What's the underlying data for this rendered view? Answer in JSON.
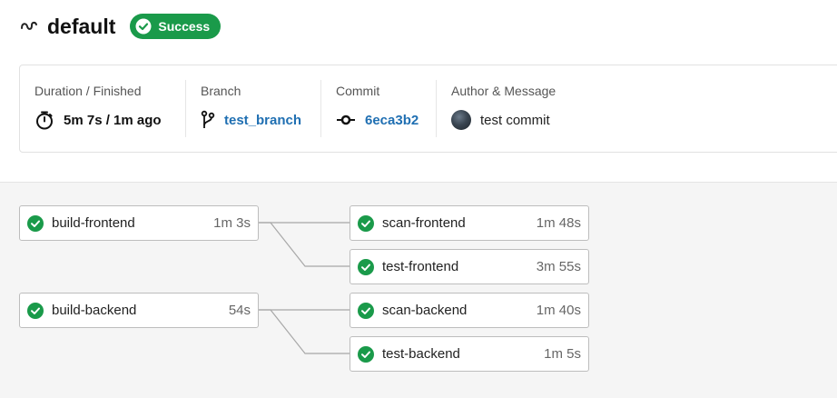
{
  "header": {
    "title": "default",
    "status": "Success",
    "status_color": "#1a9a4a",
    "icon": "workflow-icon"
  },
  "info": {
    "duration": {
      "label": "Duration / Finished",
      "value": "5m 7s / 1m ago",
      "icon": "stopwatch-icon"
    },
    "branch": {
      "label": "Branch",
      "value": "test_branch",
      "icon": "git-branch-icon"
    },
    "commit": {
      "label": "Commit",
      "value": "6eca3b2",
      "icon": "git-commit-icon"
    },
    "author": {
      "label": "Author & Message",
      "value": "test commit",
      "icon": "avatar"
    }
  },
  "jobs": [
    {
      "name": "build-frontend",
      "duration": "1m 3s",
      "status": "success"
    },
    {
      "name": "scan-frontend",
      "duration": "1m 48s",
      "status": "success"
    },
    {
      "name": "test-frontend",
      "duration": "3m 55s",
      "status": "success"
    },
    {
      "name": "build-backend",
      "duration": "54s",
      "status": "success"
    },
    {
      "name": "scan-backend",
      "duration": "1m 40s",
      "status": "success"
    },
    {
      "name": "test-backend",
      "duration": "1m 5s",
      "status": "success"
    }
  ],
  "colors": {
    "success": "#1a9a4a",
    "link": "#1f6fb2"
  }
}
